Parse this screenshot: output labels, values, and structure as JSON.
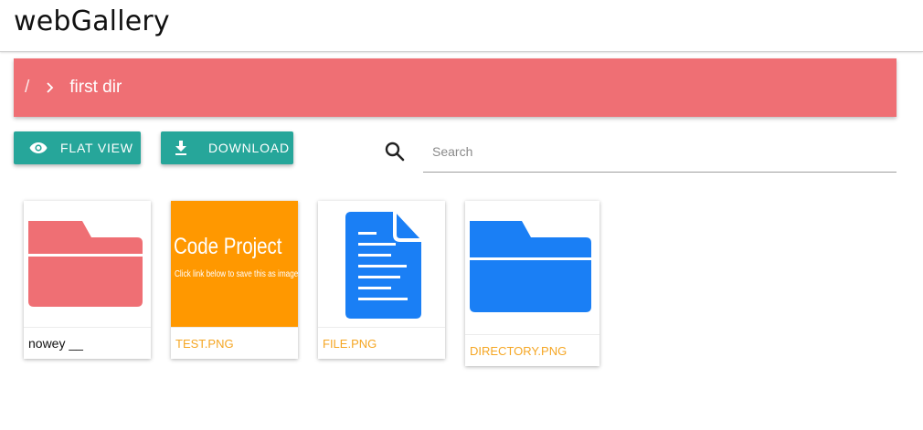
{
  "app": {
    "title": "webGallery"
  },
  "breadcrumb": {
    "root": "/",
    "current": "first dir"
  },
  "toolbar": {
    "flat_view_label": "FLAT VIEW",
    "download_label": "DOWNLOAD"
  },
  "search": {
    "placeholder": "Search",
    "value": ""
  },
  "items": [
    {
      "label": "nowey __",
      "type": "folder",
      "icon": "folder-icon",
      "color": "#ef6f74"
    },
    {
      "label": "TEST.PNG",
      "type": "image",
      "preview_title": "Code Project",
      "preview_subtitle": "Click link below to save this as image",
      "color": "#ff9800"
    },
    {
      "label": "FILE.PNG",
      "type": "image",
      "icon": "document-icon",
      "color": "#1a7ff5"
    },
    {
      "label": "DIRECTORY.PNG",
      "type": "image",
      "icon": "folder-icon",
      "color": "#1a7ff5"
    }
  ],
  "colors": {
    "accent": "#26a69a",
    "breadcrumb": "#ef6f74",
    "file_label": "#f5a623"
  }
}
